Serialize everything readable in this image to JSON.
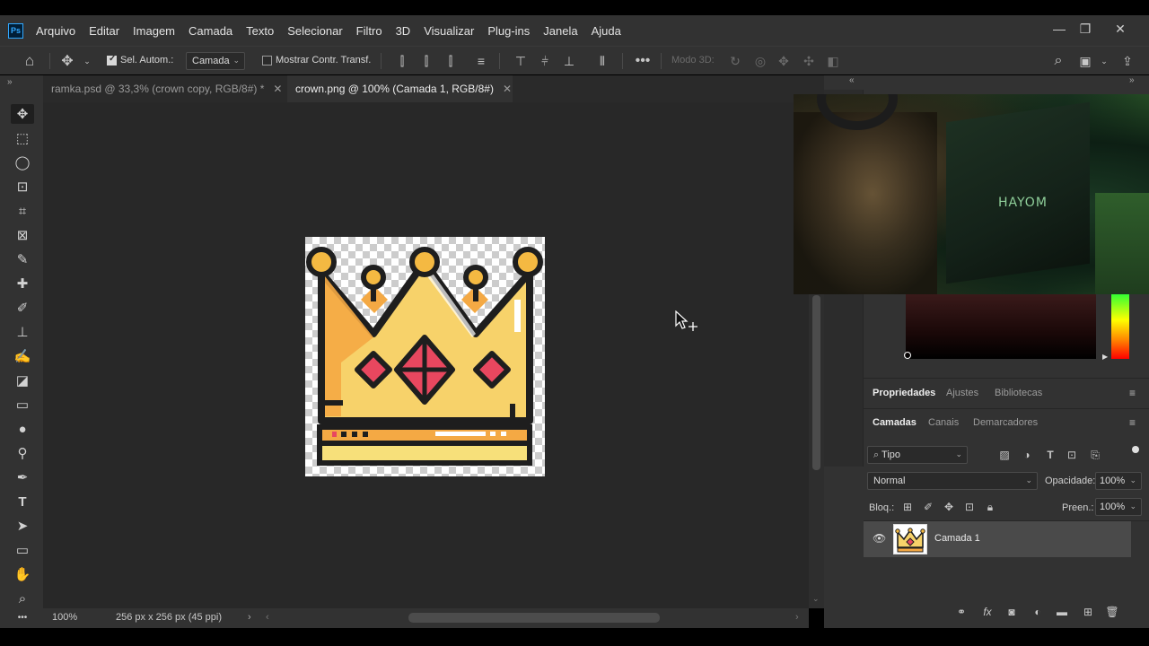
{
  "menubar": {
    "app_logo": "Ps",
    "items": [
      "Arquivo",
      "Editar",
      "Imagem",
      "Camada",
      "Texto",
      "Selecionar",
      "Filtro",
      "3D",
      "Visualizar",
      "Plug-ins",
      "Janela",
      "Ajuda"
    ]
  },
  "options": {
    "auto_select_label": "Sel. Autom.:",
    "auto_select_target": "Camada",
    "show_transform_label": "Mostrar Contr. Transf.",
    "mode3d_label": "Modo 3D:"
  },
  "tabs": [
    {
      "label": "ramka.psd @ 33,3% (crown copy, RGB/8#) *"
    },
    {
      "label": "crown.png @ 100% (Camada 1, RGB/8#)"
    }
  ],
  "status": {
    "zoom": "100%",
    "dimensions": "256 px x 256 px (45 ppi)"
  },
  "webcam": {
    "case_brand": "HAYOM"
  },
  "properties_tabs": [
    "Propriedades",
    "Ajustes",
    "Bibliotecas"
  ],
  "layers_tabs": [
    "Camadas",
    "Canais",
    "Demarcadores"
  ],
  "layers": {
    "filter_label": "Tipo",
    "blend_mode": "Normal",
    "opacity_label": "Opacidade:",
    "opacity_value": "100%",
    "lock_label": "Bloq.:",
    "fill_label": "Preen.:",
    "fill_value": "100%",
    "items": [
      {
        "name": "Camada 1"
      }
    ]
  },
  "colors": {
    "accent_blue": "#31a8ff",
    "crown_outline": "#1e1e1e",
    "crown_gold": "#f7d26a",
    "crown_orange": "#f4a944",
    "crown_gem": "#e8475f"
  }
}
